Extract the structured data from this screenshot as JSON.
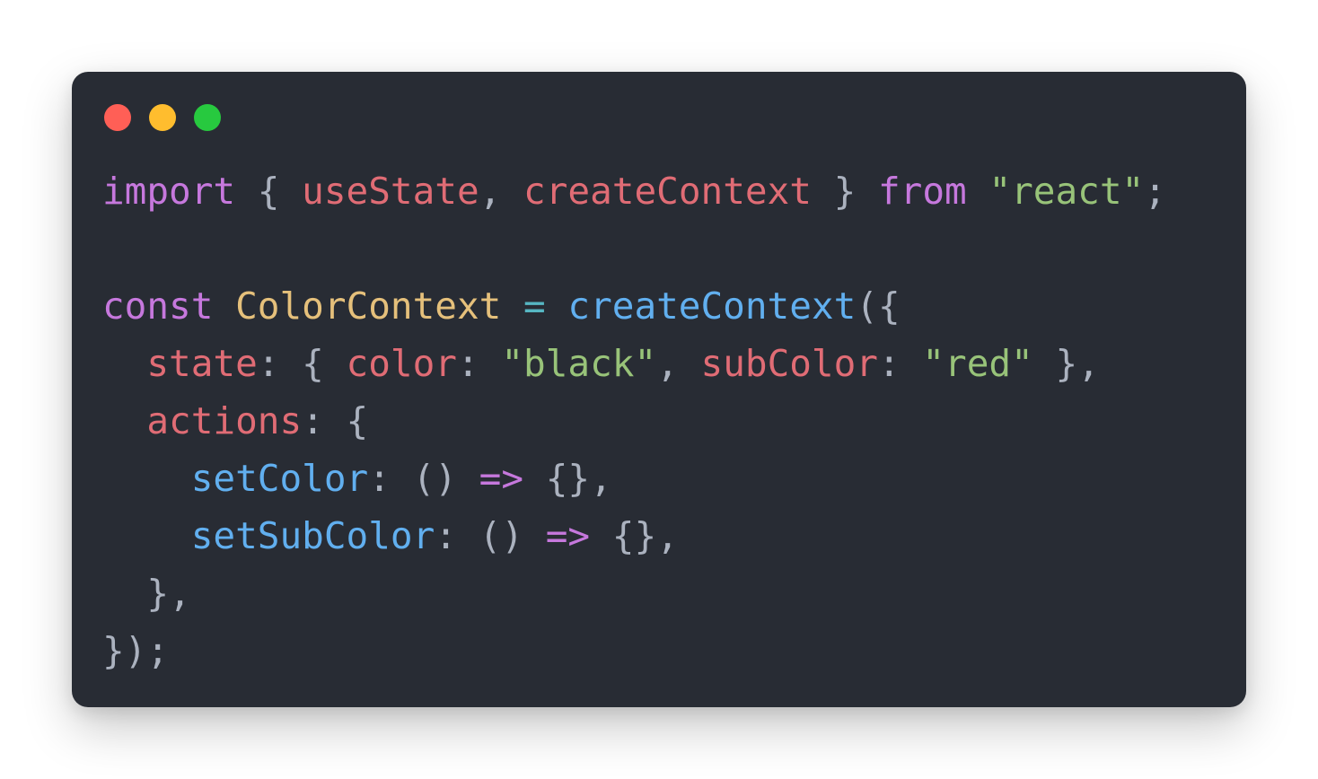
{
  "window": {
    "controls": [
      "close-dot",
      "minimize-dot",
      "zoom-dot"
    ],
    "colors": {
      "background": "#282c34",
      "close": "#ff5f56",
      "minimize": "#ffbd2e",
      "zoom": "#27c93f"
    }
  },
  "code": {
    "language": "javascript",
    "lines": [
      "import { useState, createContext } from \"react\";",
      "",
      "const ColorContext = createContext({",
      "  state: { color: \"black\", subColor: \"red\" },",
      "  actions: {",
      "    setColor: () => {},",
      "    setSubColor: () => {},",
      "  },",
      "});"
    ],
    "tokens": {
      "l1": [
        "import",
        " { ",
        "useState",
        ", ",
        "createContext",
        " } ",
        "from",
        " ",
        "\"react\"",
        ";"
      ],
      "l3": [
        "const",
        " ",
        "ColorContext",
        " ",
        "=",
        " ",
        "createContext",
        "({"
      ],
      "l4": [
        "  ",
        "state",
        ": { ",
        "color",
        ": ",
        "\"black\"",
        ", ",
        "subColor",
        ": ",
        "\"red\"",
        " },"
      ],
      "l5": [
        "  ",
        "actions",
        ": {"
      ],
      "l6": [
        "    ",
        "setColor",
        ": () ",
        "=>",
        " {},"
      ],
      "l7": [
        "    ",
        "setSubColor",
        ": () ",
        "=>",
        " {},"
      ],
      "l8": [
        "  },"
      ],
      "l9": [
        "});"
      ]
    }
  }
}
